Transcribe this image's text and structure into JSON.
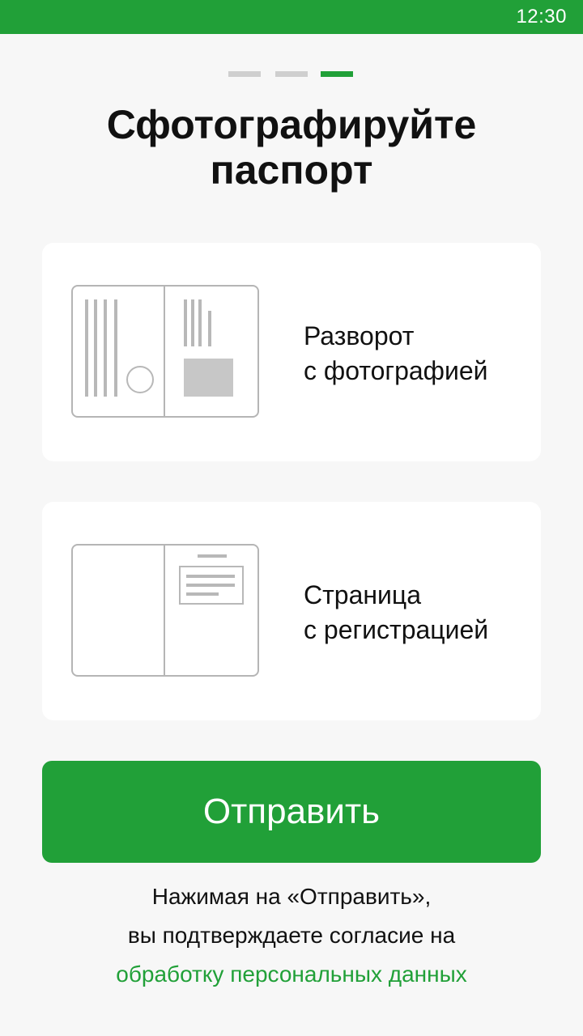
{
  "status_bar": {
    "time": "12:30"
  },
  "stepper": {
    "total": 3,
    "current": 3,
    "active_color": "#21a038",
    "inactive_color": "#cfcfcf"
  },
  "title": {
    "line1": "Сфотографируйте",
    "line2": "паспорт"
  },
  "cards": [
    {
      "line1": "Разворот",
      "line2": "с фотографией",
      "icon": "passport-photo-spread-icon"
    },
    {
      "line1": "Страница",
      "line2": "с регистрацией",
      "icon": "passport-registration-page-icon"
    }
  ],
  "submit_button": {
    "label": "Отправить"
  },
  "consent": {
    "line1": "Нажимая на «Отправить»,",
    "line2": "вы подтверждаете согласие на",
    "link": "обработку персональных данных"
  },
  "colors": {
    "brand": "#21a038",
    "background": "#f7f7f7",
    "card": "#ffffff"
  }
}
